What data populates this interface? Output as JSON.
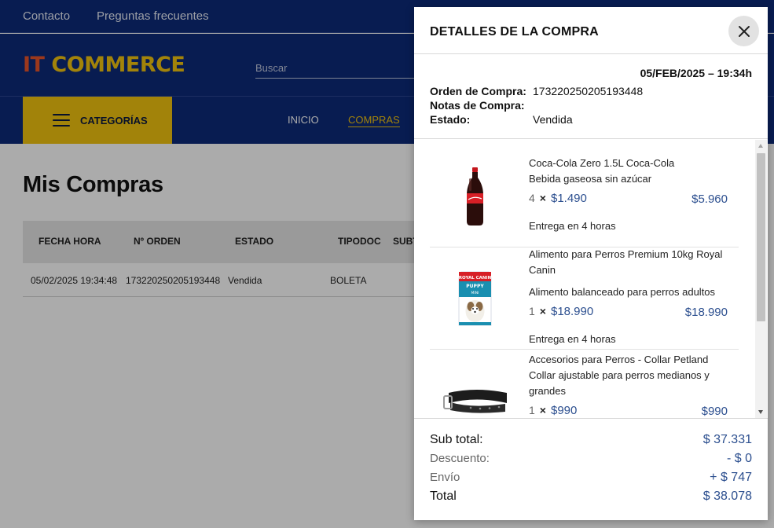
{
  "topbar": {
    "links": [
      "Contacto",
      "Preguntas frecuentes"
    ]
  },
  "header": {
    "logo_part1": "IT",
    "logo_part2": "COMMERCE",
    "search_placeholder": "Buscar"
  },
  "nav": {
    "categories_label": "CATEGORÍAS",
    "links": [
      "INICIO",
      "COMPRAS"
    ],
    "active": "COMPRAS"
  },
  "page": {
    "title": "Mis Compras",
    "table": {
      "columns": [
        "FECHA HORA",
        "Nº ORDEN",
        "ESTADO",
        "TIPODOC",
        "SUBT"
      ],
      "rows": [
        {
          "fecha_hora": "05/02/2025 19:34:48",
          "orden": "173220250205193448",
          "estado": "Vendida",
          "tipodoc": "BOLETA"
        }
      ]
    }
  },
  "modal": {
    "title": "DETALLES DE LA COMPRA",
    "date": "05/FEB/2025 – 19:34h",
    "info": [
      {
        "label": "Orden de Compra:",
        "value": "173220250205193448"
      },
      {
        "label": "Notas de Compra:",
        "value": ""
      },
      {
        "label": "Estado:",
        "value": "Vendida"
      }
    ],
    "items": [
      {
        "name": "Coca-Cola Zero 1.5L Coca-Cola",
        "description": "Bebida gaseosa sin azúcar",
        "qty": "4",
        "unit_price": "$1.490",
        "total": "$5.960",
        "delivery": "Entrega en 4 horas",
        "image_icon": "soda-bottle-icon"
      },
      {
        "name": "Alimento para Perros Premium 10kg Royal Canin",
        "description": "Alimento balanceado para perros adultos",
        "qty": "1",
        "unit_price": "$18.990",
        "total": "$18.990",
        "delivery": "Entrega en 4 horas",
        "image_icon": "dog-food-bag-icon",
        "bag_brand": "ROYAL CANIN",
        "bag_label": "PUPPY",
        "bag_sublabel": "MINI"
      },
      {
        "name": "Accesorios para Perros - Collar Petland",
        "description": "Collar ajustable para perros medianos y grandes",
        "qty": "1",
        "unit_price": "$990",
        "total": "$990",
        "image_icon": "dog-collar-icon"
      }
    ],
    "multiply_sign": "×",
    "totals": {
      "subtotal_label": "Sub total:",
      "subtotal": "$ 37.331",
      "discount_label": "Descuento:",
      "discount": "- $ 0",
      "shipping_label": "Envío",
      "shipping": "+ $ 747",
      "total_label": "Total",
      "total": "$ 38.078"
    }
  },
  "colors": {
    "navy": "#0d2a7a",
    "yellow": "#f2c40f",
    "orange": "#e8542a",
    "price_blue": "#2c4f8f"
  }
}
